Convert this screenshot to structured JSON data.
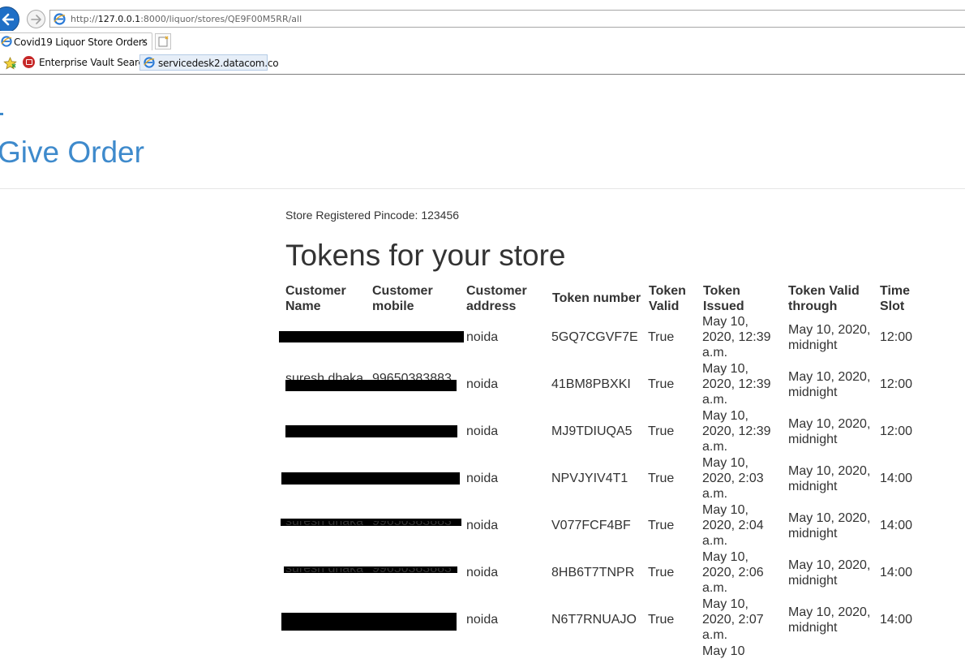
{
  "browser": {
    "url_prefix": "http://",
    "url_host": "127.0.0.1",
    "url_rest": ":8000/liquor/stores/QE9F00M5RR/all",
    "tab_title": "Covid19 Liquor Store Orders",
    "tab_close": "×",
    "favorites": [
      {
        "label": "Enterprise Vault Search"
      },
      {
        "label": "servicedesk2.datacom.co"
      }
    ]
  },
  "page": {
    "heading": "Give Order",
    "pincode_text": "Store Registered Pincode: 123456",
    "tokens_title": "Tokens for your store"
  },
  "table": {
    "headers": [
      "Customer Name",
      "Customer mobile",
      "Customer address",
      "Token number",
      "Token Valid",
      "Token Issued",
      "Token Valid through",
      "Time Slot"
    ],
    "rows": [
      {
        "address": "noida",
        "token": "5GQ7CGVF7E",
        "valid": "True",
        "issued": "May 10, 2020, 12:39 a.m.",
        "through": "May 10, 2020, midnight",
        "slot": "12:00"
      },
      {
        "name_partial": "suresh dhaka",
        "mobile_partial": "99650383883",
        "address": "noida",
        "token": "41BM8PBXKI",
        "valid": "True",
        "issued": "May 10, 2020, 12:39 a.m.",
        "through": "May 10, 2020, midnight",
        "slot": "12:00"
      },
      {
        "address": "noida",
        "token": "MJ9TDIUQA5",
        "valid": "True",
        "issued": "May 10, 2020, 12:39 a.m.",
        "through": "May 10, 2020, midnight",
        "slot": "12:00"
      },
      {
        "address": "noida",
        "token": "NPVJYIV4T1",
        "valid": "True",
        "issued": "May 10, 2020, 2:03 a.m.",
        "through": "May 10, 2020, midnight",
        "slot": "14:00"
      },
      {
        "name_partial": "suresh dhaka",
        "mobile_partial": "99650383883",
        "address": "noida",
        "token": "V077FCF4BF",
        "valid": "True",
        "issued": "May 10, 2020, 2:04 a.m.",
        "through": "May 10, 2020, midnight",
        "slot": "14:00"
      },
      {
        "name_partial": "suresh dhaka",
        "mobile_partial": "99650383883",
        "address": "noida",
        "token": "8HB6T7TNPR",
        "valid": "True",
        "issued": "May 10, 2020, 2:06 a.m.",
        "through": "May 10, 2020, midnight",
        "slot": "14:00"
      },
      {
        "address": "noida",
        "token": "N6T7RNUAJO",
        "valid": "True",
        "issued": "May 10, 2020, 2:07 a.m.",
        "through": "May 10, 2020, midnight",
        "slot": "14:00"
      }
    ],
    "partial_next_row_issued": "May 10"
  }
}
